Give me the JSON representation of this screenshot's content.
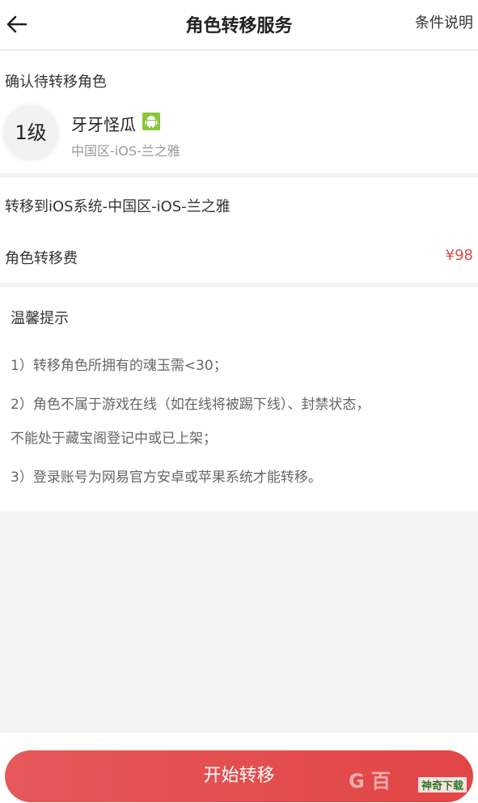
{
  "header": {
    "title": "角色转移服务",
    "link": "条件说明"
  },
  "role_section": {
    "heading": "确认待转移角色",
    "level_badge": "1级",
    "role_name": "牙牙怪瓜",
    "platform_icon": "android-icon",
    "server": "中国区-iOS-兰之雅"
  },
  "target_section": {
    "target_text": "转移到iOS系统-中国区-iOS-兰之雅",
    "fee_label": "角色转移费",
    "fee_price": "¥98"
  },
  "tips_section": {
    "title": "温馨提示",
    "lines": [
      "1）转移角色所拥有的魂玉需<30；",
      "2）角色不属于游戏在线（如在线将被踢下线）、封禁状态，",
      "不能处于藏宝阁登记中或已上架；",
      "3）登录账号为网易官方安卓或苹果系统才能转移。"
    ]
  },
  "footer": {
    "button_label": "开始转移",
    "watermark_left": "G 百",
    "watermark_site": "神奇下载"
  },
  "colors": {
    "accent": "#e24545",
    "price": "#e04848",
    "android_badge": "#8cc63f"
  }
}
